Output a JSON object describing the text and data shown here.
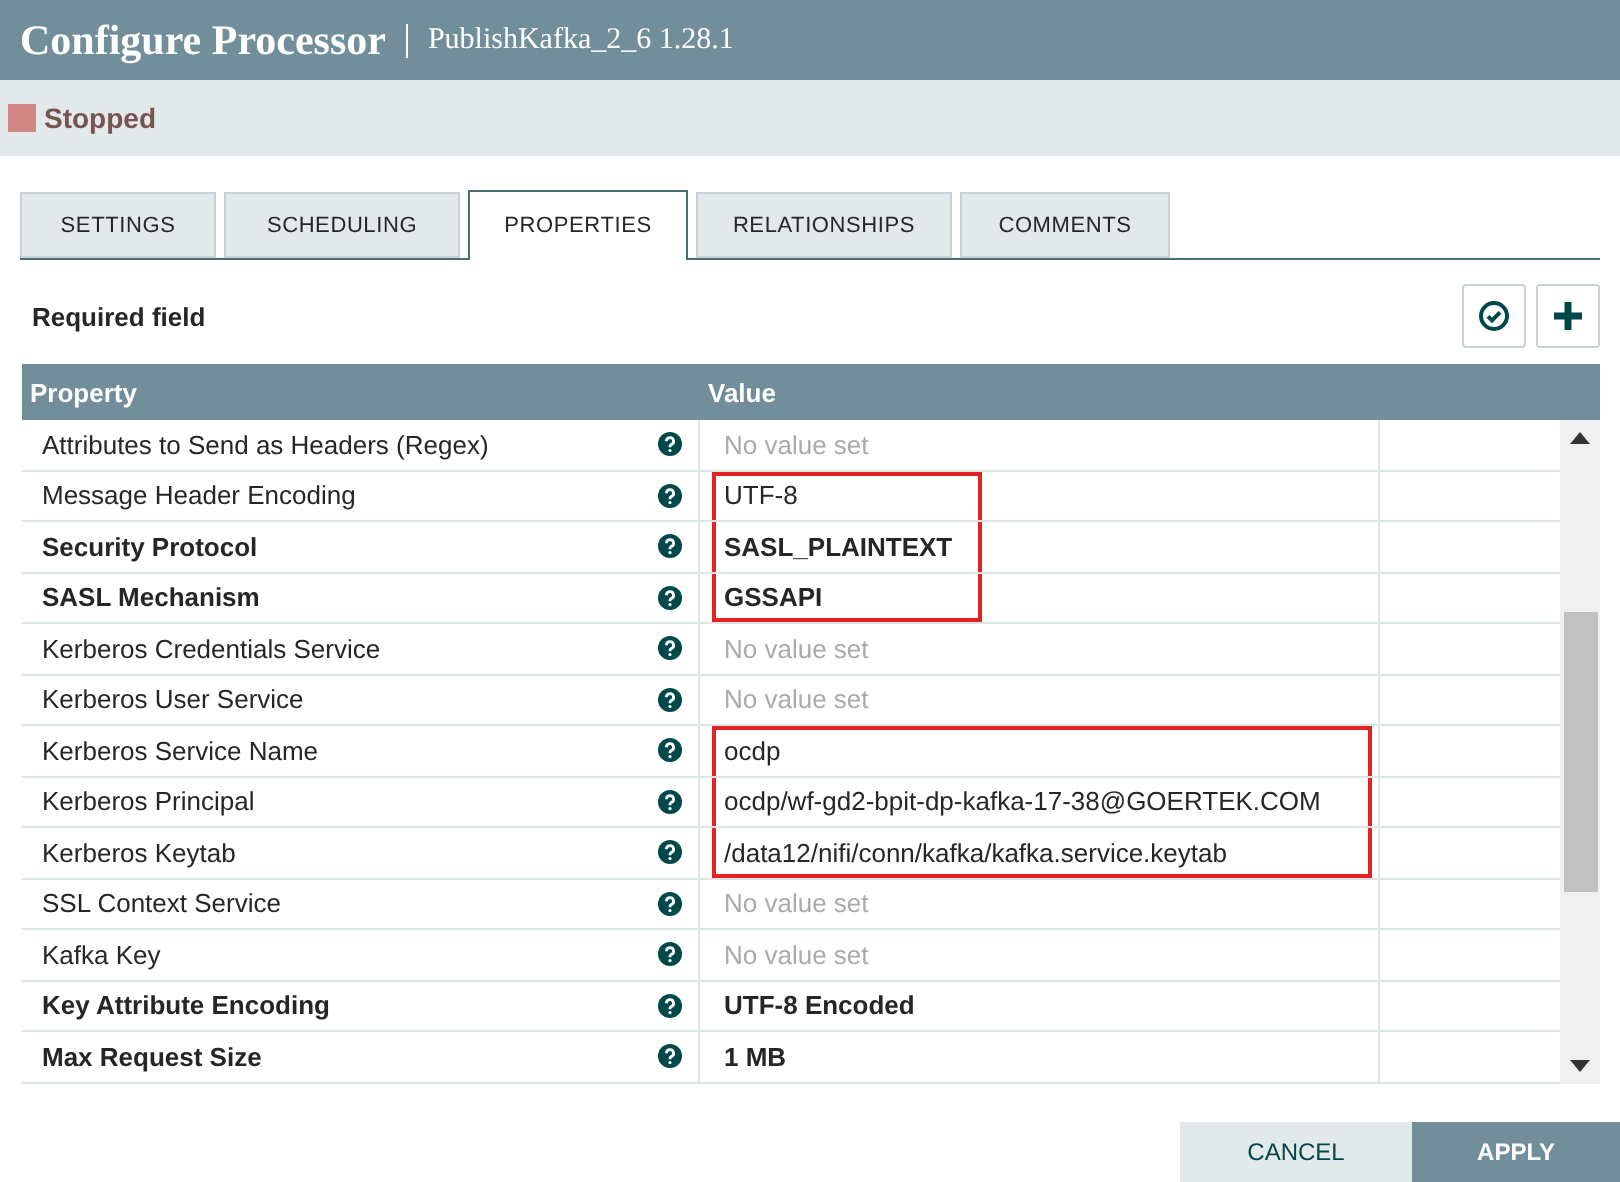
{
  "header": {
    "title": "Configure Processor",
    "subtitle": "PublishKafka_2_6 1.28.1"
  },
  "status": {
    "label": "Stopped"
  },
  "tabs": [
    {
      "label": "SETTINGS",
      "selected": false
    },
    {
      "label": "SCHEDULING",
      "selected": false
    },
    {
      "label": "PROPERTIES",
      "selected": true
    },
    {
      "label": "RELATIONSHIPS",
      "selected": false
    },
    {
      "label": "COMMENTS",
      "selected": false
    }
  ],
  "required_label": "Required field",
  "table": {
    "columns": [
      "Property",
      "Value"
    ],
    "rows": [
      {
        "property": "Attributes to Send as Headers (Regex)",
        "value": "No value set",
        "required": false,
        "is_set": false,
        "boxed": false
      },
      {
        "property": "Message Header Encoding",
        "value": "UTF-8",
        "required": false,
        "is_set": true,
        "boxed": true
      },
      {
        "property": "Security Protocol",
        "value": "SASL_PLAINTEXT",
        "required": true,
        "is_set": true,
        "boxed": true
      },
      {
        "property": "SASL Mechanism",
        "value": "GSSAPI",
        "required": true,
        "is_set": true,
        "boxed": true
      },
      {
        "property": "Kerberos Credentials Service",
        "value": "No value set",
        "required": false,
        "is_set": false,
        "boxed": false
      },
      {
        "property": "Kerberos User Service",
        "value": "No value set",
        "required": false,
        "is_set": false,
        "boxed": false
      },
      {
        "property": "Kerberos Service Name",
        "value": "ocdp",
        "required": false,
        "is_set": true,
        "boxed": true
      },
      {
        "property": "Kerberos Principal",
        "value": "ocdp/wf-gd2-bpit-dp-kafka-17-38@GOERTEK.COM",
        "required": false,
        "is_set": true,
        "boxed": true
      },
      {
        "property": "Kerberos Keytab",
        "value": "/data12/nifi/conn/kafka/kafka.service.keytab",
        "required": false,
        "is_set": true,
        "boxed": true
      },
      {
        "property": "SSL Context Service",
        "value": "No value set",
        "required": false,
        "is_set": false,
        "boxed": false
      },
      {
        "property": "Kafka Key",
        "value": "No value set",
        "required": false,
        "is_set": false,
        "boxed": false
      },
      {
        "property": "Key Attribute Encoding",
        "value": "UTF-8 Encoded",
        "required": true,
        "is_set": true,
        "boxed": false
      },
      {
        "property": "Max Request Size",
        "value": "1 MB",
        "required": true,
        "is_set": true,
        "boxed": false
      }
    ]
  },
  "buttons": [
    {
      "label": "CANCEL",
      "kind": "secondary"
    },
    {
      "label": "APPLY",
      "kind": "primary"
    }
  ]
}
